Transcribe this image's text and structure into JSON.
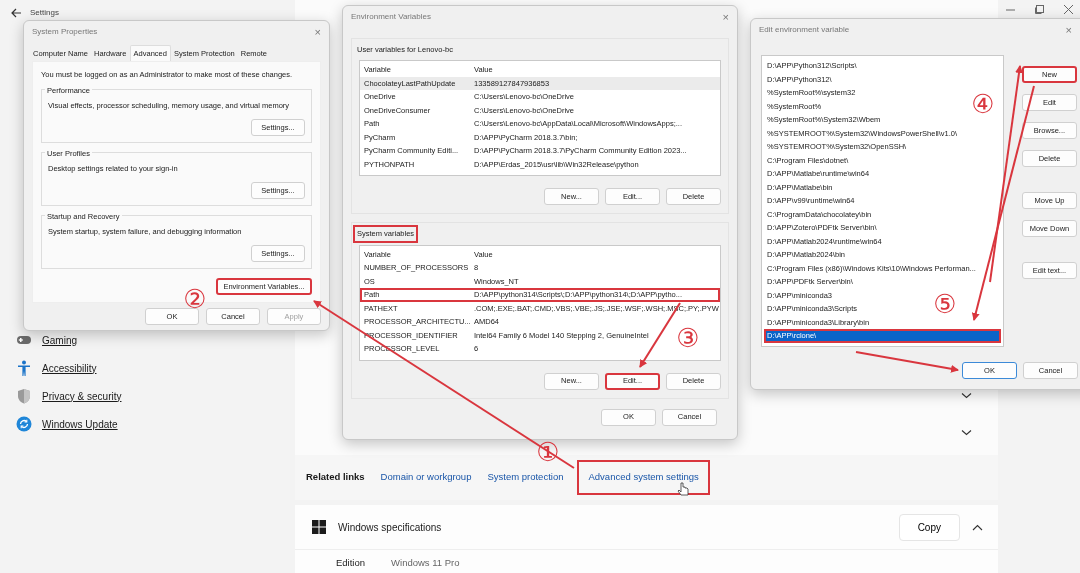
{
  "settings": {
    "title": "Settings",
    "nav": [
      {
        "label": "Gaming"
      },
      {
        "label": "Accessibility"
      },
      {
        "label": "Privacy & security"
      },
      {
        "label": "Windows Update"
      }
    ],
    "related_links": {
      "label": "Related links",
      "links": [
        {
          "label": "Domain or workgroup",
          "highlighted": false
        },
        {
          "label": "System protection",
          "highlighted": false
        },
        {
          "label": "Advanced system settings",
          "highlighted": true
        }
      ]
    },
    "specifications": {
      "title": "Windows specifications",
      "copy": "Copy",
      "rows": [
        {
          "label": "Edition",
          "value": "Windows 11 Pro"
        }
      ]
    }
  },
  "system_properties": {
    "title": "System Properties",
    "close": "×",
    "tabs": [
      {
        "label": "Computer Name",
        "selected": false
      },
      {
        "label": "Hardware",
        "selected": false
      },
      {
        "label": "Advanced",
        "selected": true
      },
      {
        "label": "System Protection",
        "selected": false
      },
      {
        "label": "Remote",
        "selected": false
      }
    ],
    "notice": "You must be logged on as an Administrator to make most of these changes.",
    "groups": [
      {
        "title": "Performance",
        "description": "Visual effects, processor scheduling, memory usage, and virtual memory",
        "button": "Settings..."
      },
      {
        "title": "User Profiles",
        "description": "Desktop settings related to your sign-in",
        "button": "Settings..."
      },
      {
        "title": "Startup and Recovery",
        "description": "System startup, system failure, and debugging information",
        "button": "Settings..."
      }
    ],
    "env_button": {
      "label": "Environment Variables...",
      "highlighted": true
    },
    "buttons": [
      {
        "label": "OK",
        "disabled": false
      },
      {
        "label": "Cancel",
        "disabled": false
      },
      {
        "label": "Apply",
        "disabled": true
      }
    ]
  },
  "environment_variables": {
    "title": "Environment Variables",
    "close": "×",
    "sections": [
      {
        "label": "User variables for Lenovo-bc",
        "highlighted": false,
        "columns": [
          "Variable",
          "Value"
        ],
        "rows": [
          {
            "variable": "ChocolateyLastPathUpdate",
            "value": "133589127847936853",
            "selected": true,
            "highlighted": false
          },
          {
            "variable": "OneDrive",
            "value": "C:\\Users\\Lenovo-bc\\OneDrive",
            "selected": false,
            "highlighted": false
          },
          {
            "variable": "OneDriveConsumer",
            "value": "C:\\Users\\Lenovo-bc\\OneDrive",
            "selected": false,
            "highlighted": false
          },
          {
            "variable": "Path",
            "value": "C:\\Users\\Lenovo-bc\\AppData\\Local\\Microsoft\\WindowsApps;...",
            "selected": false,
            "highlighted": false
          },
          {
            "variable": "PyCharm",
            "value": "D:\\APP\\PyCharm 2018.3.7\\bin;",
            "selected": false,
            "highlighted": false
          },
          {
            "variable": "PyCharm Community Editi...",
            "value": "D:\\APP\\PyCharm 2018.3.7\\PyCharm Community Edition 2023...",
            "selected": false,
            "highlighted": false
          },
          {
            "variable": "PYTHONPATH",
            "value": "D:\\APP\\Erdas_2015\\usr\\lib\\Win32Release\\python",
            "selected": false,
            "highlighted": false
          }
        ],
        "buttons": [
          {
            "label": "New...",
            "highlighted": false
          },
          {
            "label": "Edit...",
            "highlighted": false
          },
          {
            "label": "Delete",
            "highlighted": false
          }
        ]
      },
      {
        "label": "System variables",
        "highlighted": true,
        "columns": [
          "Variable",
          "Value"
        ],
        "rows": [
          {
            "variable": "NUMBER_OF_PROCESSORS",
            "value": "8",
            "selected": false,
            "highlighted": false
          },
          {
            "variable": "OS",
            "value": "Windows_NT",
            "selected": false,
            "highlighted": false
          },
          {
            "variable": "Path",
            "value": "D:\\APP\\python314\\Scripts\\;D:\\APP\\python314\\;D:\\APP\\pytho...",
            "selected": false,
            "highlighted": true
          },
          {
            "variable": "PATHEXT",
            "value": ".COM;.EXE;.BAT;.CMD;.VBS;.VBE;.JS;.JSE;.WSF;.WSH;.MSC;.PY;.PYW",
            "selected": false,
            "highlighted": false
          },
          {
            "variable": "PROCESSOR_ARCHITECTU...",
            "value": "AMD64",
            "selected": false,
            "highlighted": false
          },
          {
            "variable": "PROCESSOR_IDENTIFIER",
            "value": "Intel64 Family 6 Model 140 Stepping 2, GenuineIntel",
            "selected": false,
            "highlighted": false
          },
          {
            "variable": "PROCESSOR_LEVEL",
            "value": "6",
            "selected": false,
            "highlighted": false
          }
        ],
        "buttons": [
          {
            "label": "New...",
            "highlighted": false
          },
          {
            "label": "Edit...",
            "highlighted": true
          },
          {
            "label": "Delete",
            "highlighted": false
          }
        ]
      }
    ],
    "buttons": [
      {
        "label": "OK"
      },
      {
        "label": "Cancel"
      }
    ]
  },
  "edit_variable": {
    "title": "Edit environment variable",
    "close": "×",
    "entries": [
      {
        "text": "D:\\APP\\Python312\\Scripts\\",
        "selected": false,
        "highlighted": false
      },
      {
        "text": "D:\\APP\\Python312\\",
        "selected": false,
        "highlighted": false
      },
      {
        "text": "%SystemRoot%\\system32",
        "selected": false,
        "highlighted": false
      },
      {
        "text": "%SystemRoot%",
        "selected": false,
        "highlighted": false
      },
      {
        "text": "%SystemRoot%\\System32\\Wbem",
        "selected": false,
        "highlighted": false
      },
      {
        "text": "%SYSTEMROOT%\\System32\\WindowsPowerShell\\v1.0\\",
        "selected": false,
        "highlighted": false
      },
      {
        "text": "%SYSTEMROOT%\\System32\\OpenSSH\\",
        "selected": false,
        "highlighted": false
      },
      {
        "text": "C:\\Program Files\\dotnet\\",
        "selected": false,
        "highlighted": false
      },
      {
        "text": "D:\\APP\\Matlabe\\runtime\\win64",
        "selected": false,
        "highlighted": false
      },
      {
        "text": "D:\\APP\\Matlabe\\bin",
        "selected": false,
        "highlighted": false
      },
      {
        "text": "D:\\APP\\v99\\runtime\\win64",
        "selected": false,
        "highlighted": false
      },
      {
        "text": "C:\\ProgramData\\chocolatey\\bin",
        "selected": false,
        "highlighted": false
      },
      {
        "text": "D:\\APP\\Zotero\\PDFtk Server\\bin\\",
        "selected": false,
        "highlighted": false
      },
      {
        "text": "D:\\APP\\Matlab2024\\runtime\\win64",
        "selected": false,
        "highlighted": false
      },
      {
        "text": "D:\\APP\\Matlab2024\\bin",
        "selected": false,
        "highlighted": false
      },
      {
        "text": "C:\\Program Files (x86)\\Windows Kits\\10\\Windows Performan...",
        "selected": false,
        "highlighted": false
      },
      {
        "text": "D:\\APP\\PDFtk Server\\bin\\",
        "selected": false,
        "highlighted": false
      },
      {
        "text": "D:\\APP\\miniconda3",
        "selected": false,
        "highlighted": false
      },
      {
        "text": "D:\\APP\\miniconda3\\Scripts",
        "selected": false,
        "highlighted": false
      },
      {
        "text": "D:\\APP\\miniconda3\\Library\\bin",
        "selected": false,
        "highlighted": false
      },
      {
        "text": "D:\\APP\\rclone\\",
        "selected": true,
        "highlighted": true
      }
    ],
    "side_buttons": [
      {
        "label": "New",
        "highlighted": true
      },
      {
        "label": "Edit",
        "highlighted": false
      },
      {
        "label": "Browse...",
        "highlighted": false
      },
      {
        "label": "Delete",
        "highlighted": false
      },
      {
        "label": "Move Up",
        "highlighted": false
      },
      {
        "label": "Move Down",
        "highlighted": false
      },
      {
        "label": "Edit text...",
        "highlighted": false
      }
    ],
    "buttons": [
      {
        "label": "OK",
        "focused": true
      },
      {
        "label": "Cancel",
        "focused": false
      }
    ]
  },
  "annotations": [
    {
      "label": "①"
    },
    {
      "label": "②"
    },
    {
      "label": "③"
    },
    {
      "label": "④"
    },
    {
      "label": "⑤"
    }
  ]
}
